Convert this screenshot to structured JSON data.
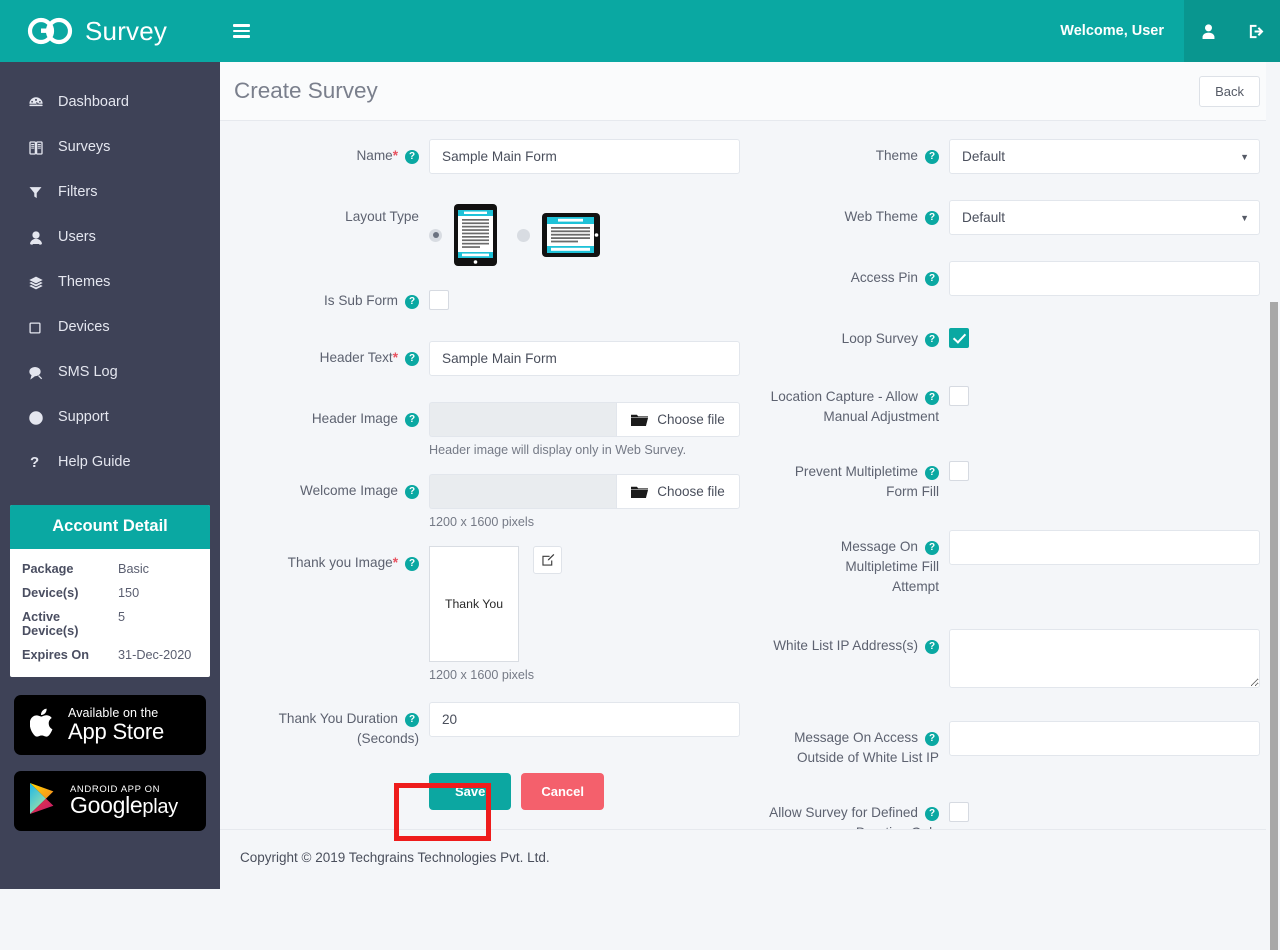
{
  "app": {
    "brand": "Survey",
    "logo_icon": "go-logo-icon",
    "menu_icon": "hamburger-menu-icon",
    "welcome": "Welcome, User",
    "user_icon": "user-icon",
    "logout_icon": "logout-icon",
    "accent_color": "#0aa8a2",
    "sidebar_color": "#3e4257"
  },
  "sidebar": {
    "items": [
      {
        "label": "Dashboard",
        "icon": "dashboard-icon"
      },
      {
        "label": "Surveys",
        "icon": "surveys-book-icon"
      },
      {
        "label": "Filters",
        "icon": "filter-funnel-icon"
      },
      {
        "label": "Users",
        "icon": "users-icon"
      },
      {
        "label": "Themes",
        "icon": "themes-layers-icon"
      },
      {
        "label": "Devices",
        "icon": "devices-tablet-icon"
      },
      {
        "label": "SMS Log",
        "icon": "sms-chat-icon"
      },
      {
        "label": "Support",
        "icon": "support-lifebuoy-icon"
      },
      {
        "label": "Help Guide",
        "icon": "question-mark-icon"
      }
    ],
    "account": {
      "title": "Account Detail",
      "rows": [
        {
          "key": "Package",
          "value": "Basic"
        },
        {
          "key": "Device(s)",
          "value": "150"
        },
        {
          "key": "Active Device(s)",
          "value": "5"
        },
        {
          "key": "Expires On",
          "value": "31-Dec-2020"
        }
      ]
    },
    "badges": {
      "apple": {
        "line1": "Available on the",
        "line2": "App Store",
        "icon": "apple-logo-icon"
      },
      "google": {
        "line1": "ANDROID APP ON",
        "line2": "Google",
        "line2b": "play",
        "icon": "google-play-triangle-icon"
      }
    }
  },
  "page": {
    "title": "Create Survey",
    "back_label": "Back",
    "footer": "Copyright © 2019 Techgrains Technologies Pvt. Ltd."
  },
  "form": {
    "left": {
      "name": {
        "label": "Name",
        "required": true,
        "value": "Sample Main Form",
        "help": "?"
      },
      "layout_type": {
        "label": "Layout Type",
        "options": [
          {
            "name": "portrait-tablet-icon",
            "selected": true
          },
          {
            "name": "landscape-tablet-icon",
            "selected": false
          }
        ]
      },
      "is_sub_form": {
        "label": "Is Sub Form",
        "checked": false,
        "help": "?"
      },
      "header_text": {
        "label": "Header Text",
        "required": true,
        "value": "Sample Main Form",
        "help": "?"
      },
      "header_image": {
        "label": "Header Image",
        "help": "?",
        "button": "Choose file",
        "value": "",
        "hint": "Header image will display only in Web Survey."
      },
      "welcome_image": {
        "label": "Welcome Image",
        "help": "?",
        "button": "Choose file",
        "value": "",
        "hint": "1200 x 1600 pixels"
      },
      "thank_you_image": {
        "label": "Thank you Image",
        "required": true,
        "help": "?",
        "thumb_text": "Thank You",
        "hint": "1200 x 1600 pixels",
        "edit_icon": "edit-pencil-icon"
      },
      "thank_you_duration": {
        "label_line1": "Thank You Duration",
        "label_line2": "(Seconds)",
        "value": "20",
        "help": "?"
      }
    },
    "right": {
      "theme": {
        "label": "Theme",
        "value": "Default",
        "help": "?",
        "options": [
          "Default"
        ]
      },
      "web_theme": {
        "label": "Web Theme",
        "value": "Default",
        "help": "?",
        "options": [
          "Default"
        ]
      },
      "access_pin": {
        "label": "Access Pin",
        "value": "",
        "help": "?"
      },
      "loop_survey": {
        "label": "Loop Survey",
        "checked": true,
        "help": "?"
      },
      "location_capture": {
        "label_line1": "Location Capture - Allow",
        "label_line2": "Manual Adjustment",
        "checked": false,
        "help": "?"
      },
      "prevent_multi": {
        "label_line1": "Prevent Multipletime",
        "label_line2": "Form Fill",
        "checked": false,
        "help": "?"
      },
      "message_multi": {
        "label_line1": "Message On",
        "label_line2": "Multipletime Fill",
        "label_line3": "Attempt",
        "value": "",
        "help": "?"
      },
      "white_list_ip": {
        "label": "White List IP Address(s)",
        "value": "",
        "help": "?"
      },
      "message_outside": {
        "label_line1": "Message On Access",
        "label_line2": "Outside of White List IP",
        "value": "",
        "help": "?"
      },
      "allow_duration": {
        "label_line1": "Allow Survey for Defined",
        "label_line2": "Duration Only",
        "checked": false,
        "help": "?"
      }
    },
    "actions": {
      "save": "Save",
      "cancel": "Cancel"
    }
  },
  "annotation": {
    "highlight_color": "#ee1c1c",
    "target": "save-button"
  }
}
